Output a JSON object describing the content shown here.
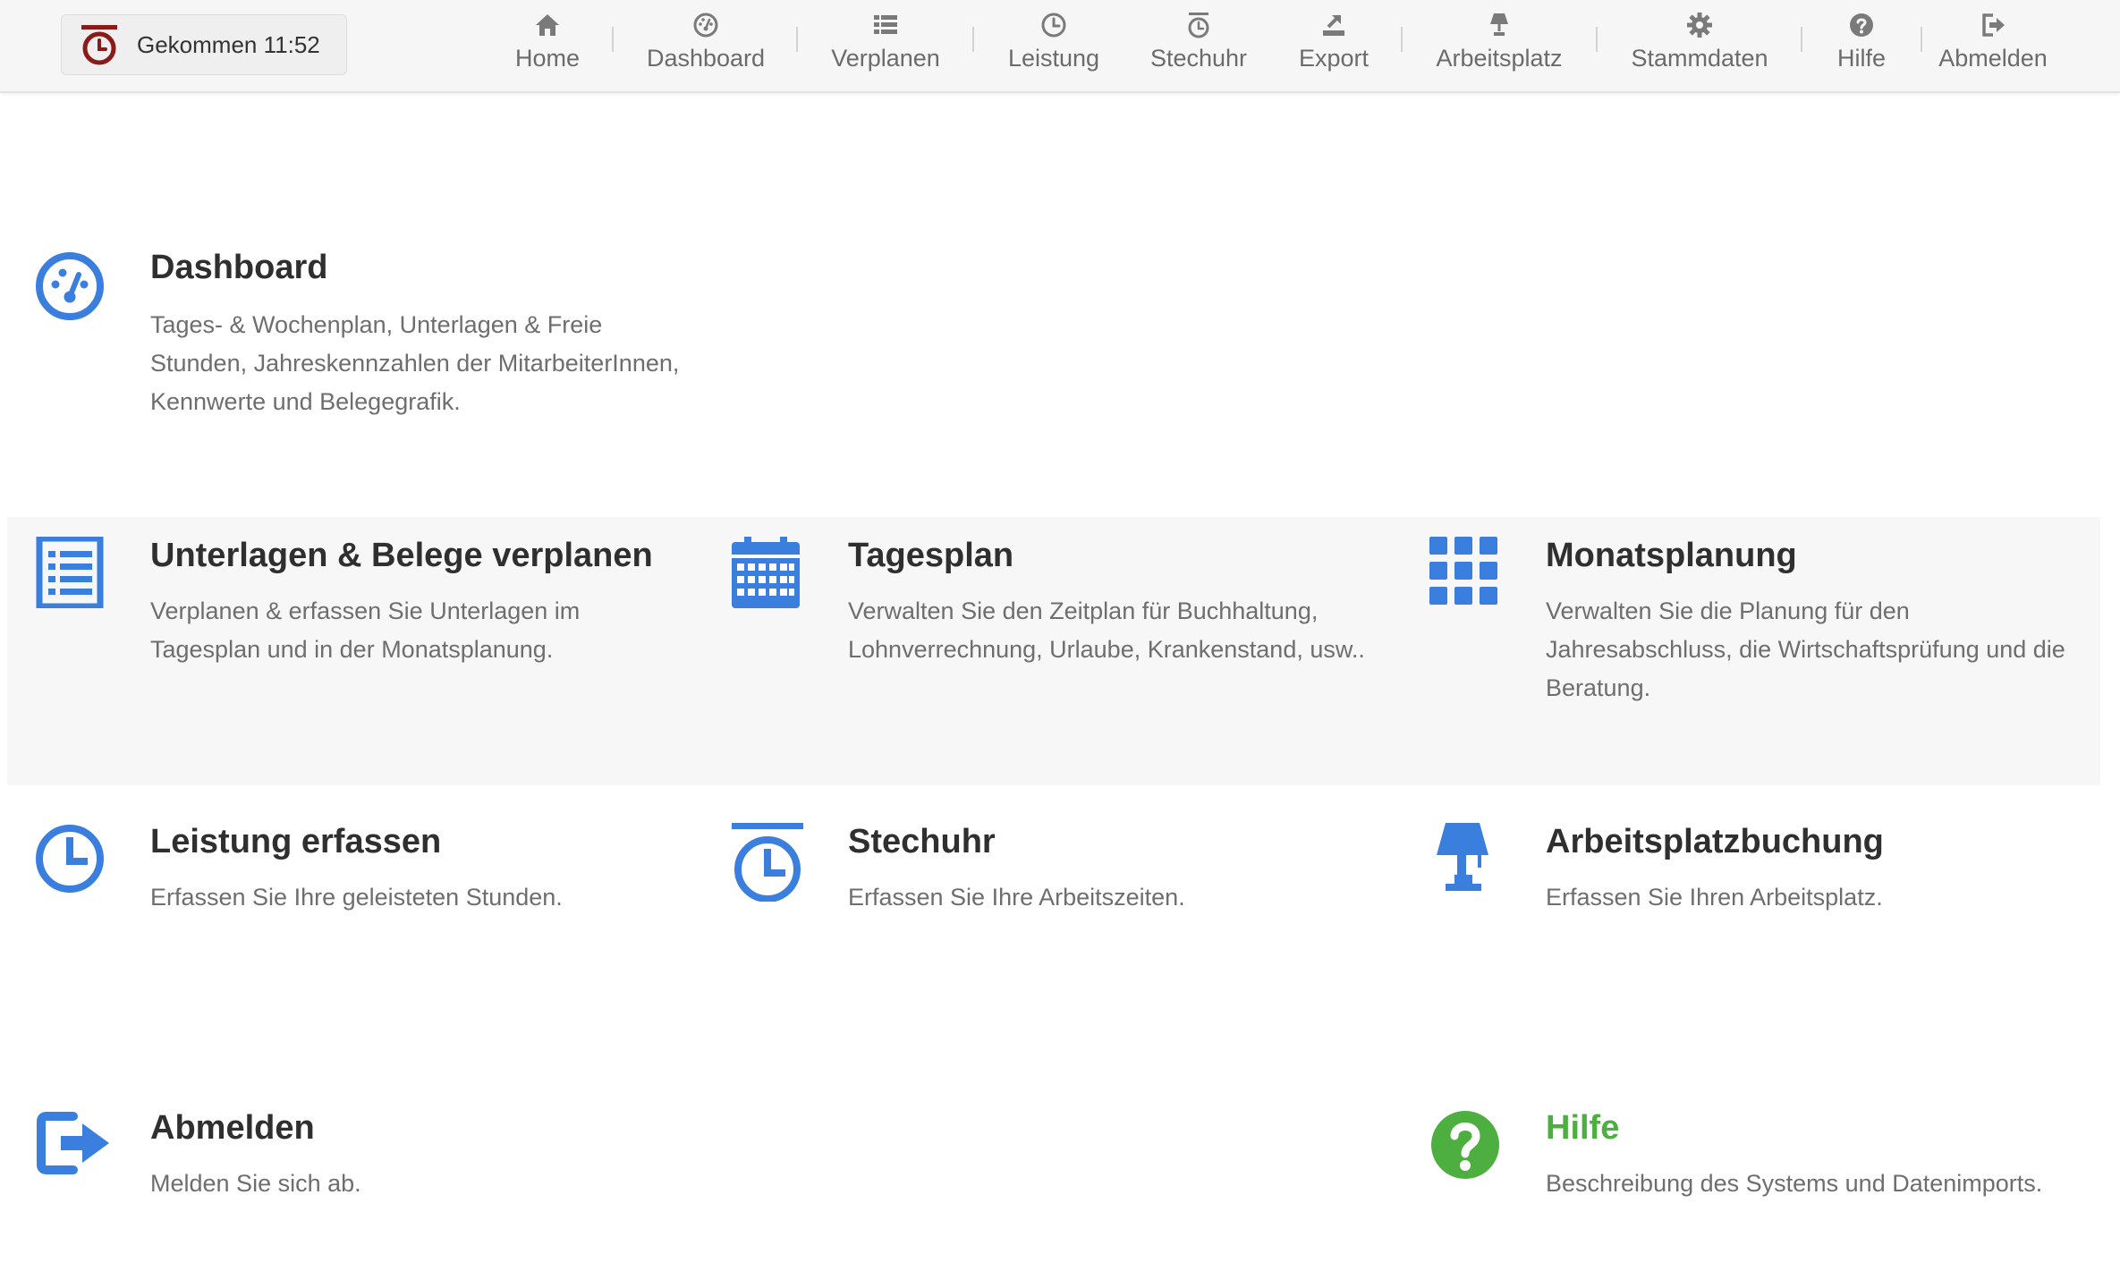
{
  "header": {
    "stamp_label": "Gekommen 11:52",
    "nav": [
      {
        "label": "Home",
        "icon": "home-icon"
      },
      {
        "label": "Dashboard",
        "icon": "dashboard-icon"
      },
      {
        "label": "Verplanen",
        "icon": "list-icon"
      },
      {
        "label": "Leistung",
        "icon": "clock-icon"
      },
      {
        "label": "Stechuhr",
        "icon": "stopwatch-icon"
      },
      {
        "label": "Export",
        "icon": "export-icon"
      },
      {
        "label": "Arbeitsplatz",
        "icon": "lamp-icon"
      },
      {
        "label": "Stammdaten",
        "icon": "gear-icon"
      },
      {
        "label": "Hilfe",
        "icon": "help-icon"
      },
      {
        "label": "Abmelden",
        "icon": "logout-icon"
      }
    ]
  },
  "tiles": {
    "dashboard": {
      "title": "Dashboard",
      "desc": "Tages- & Wochenplan, Unterlagen & Freie Stunden, Jahreskennzahlen der MitarbeiterInnen, Kennwerte und Belegegrafik."
    },
    "verplanen": {
      "title": "Unterlagen & Belege verplanen",
      "desc": "Verplanen & erfassen Sie Unterlagen im Tagesplan und in der Monatsplanung."
    },
    "tagesplan": {
      "title": "Tagesplan",
      "desc": "Verwalten Sie den Zeitplan für Buchhaltung, Lohnverrechnung, Urlaube, Krankenstand, usw.."
    },
    "monatsplanung": {
      "title": "Monatsplanung",
      "desc": "Verwalten Sie die Planung für den Jahresabschluss, die Wirtschaftsprüfung und die Beratung."
    },
    "leistung": {
      "title": "Leistung erfassen",
      "desc": "Erfassen Sie Ihre geleisteten Stunden."
    },
    "stechuhr": {
      "title": "Stechuhr",
      "desc": "Erfassen Sie Ihre Arbeitszeiten."
    },
    "arbeitsplatz": {
      "title": "Arbeitsplatzbuchung",
      "desc": "Erfassen Sie Ihren Arbeitsplatz."
    },
    "abmelden": {
      "title": "Abmelden",
      "desc": "Melden Sie sich ab."
    },
    "hilfe": {
      "title": "Hilfe",
      "desc": "Beschreibung des Systems und Datenimports."
    }
  },
  "colors": {
    "accent_blue": "#3a7fdd",
    "help_green": "#4caf3f",
    "stamp_red": "#8b1a1a",
    "nav_icon_grey": "#7a7a7a"
  }
}
